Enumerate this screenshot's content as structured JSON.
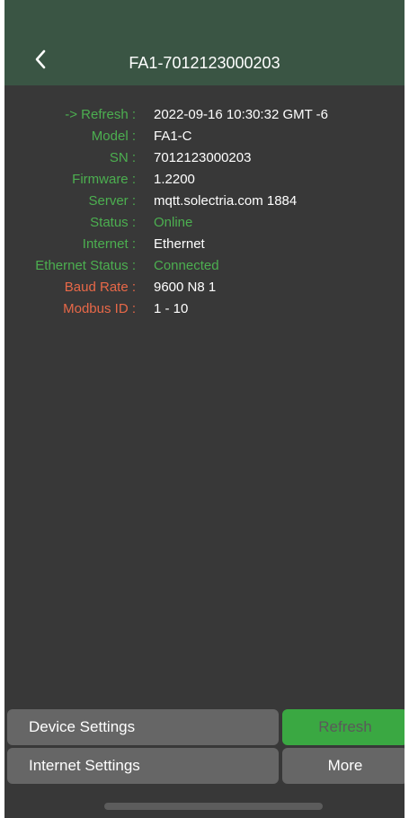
{
  "header": {
    "title": "FA1-7012123000203",
    "back_icon": "chevron-left-icon"
  },
  "info": {
    "refresh": {
      "label": "-> Refresh :",
      "value": "2022-09-16 10:30:32 GMT -6"
    },
    "model": {
      "label": "Model :",
      "value": "FA1-C"
    },
    "sn": {
      "label": "SN :",
      "value": "7012123000203"
    },
    "firmware": {
      "label": "Firmware :",
      "value": "1.2200"
    },
    "server": {
      "label": "Server :",
      "value": "mqtt.solectria.com 1884"
    },
    "status": {
      "label": "Status :",
      "value": "Online"
    },
    "internet": {
      "label": "Internet :",
      "value": "Ethernet"
    },
    "ethernet_status": {
      "label": "Ethernet Status :",
      "value": "Connected"
    },
    "baud_rate": {
      "label": "Baud Rate :",
      "value": "9600 N8 1"
    },
    "modbus_id": {
      "label": "Modbus ID :",
      "value": "1 - 10"
    }
  },
  "buttons": {
    "device_settings": "Device Settings",
    "refresh": "Refresh",
    "internet_settings": "Internet Settings",
    "more": "More"
  },
  "colors": {
    "header_bg": "#3a5544",
    "body_bg": "#383838",
    "green_label": "#4caf50",
    "warning_label": "#e86848",
    "button_grey": "#666666",
    "button_green": "#3aa842"
  }
}
